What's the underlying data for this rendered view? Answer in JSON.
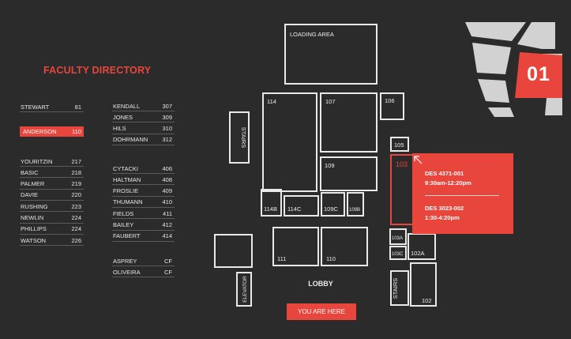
{
  "directory": {
    "title": "FACULTY DIRECTORY",
    "col1_groups": [
      [
        {
          "name": "STEWART",
          "room": "81"
        }
      ],
      [
        {
          "name": "ANDERSON",
          "room": "110",
          "highlight": true
        }
      ],
      [
        {
          "name": "YOURITZIN",
          "room": "217"
        },
        {
          "name": "BASIC",
          "room": "218"
        },
        {
          "name": "PALMER",
          "room": "219"
        },
        {
          "name": "DAVIE",
          "room": "220"
        },
        {
          "name": "RUSHING",
          "room": "223"
        },
        {
          "name": "NEWLIN",
          "room": "224"
        },
        {
          "name": "PHILLIPS",
          "room": "224"
        },
        {
          "name": "WATSON",
          "room": "226"
        }
      ]
    ],
    "col2_groups": [
      [
        {
          "name": "KENDALL",
          "room": "307"
        },
        {
          "name": "JONES",
          "room": "309"
        },
        {
          "name": "HILS",
          "room": "310"
        },
        {
          "name": "DOHRMANN",
          "room": "312"
        }
      ],
      [
        {
          "name": "CYTACKI",
          "room": "406"
        },
        {
          "name": "HALTMAN",
          "room": "408"
        },
        {
          "name": "FROSLIE",
          "room": "409"
        },
        {
          "name": "THUMANN",
          "room": "410"
        },
        {
          "name": "FIELDS",
          "room": "411"
        },
        {
          "name": "BAILEY",
          "room": "412"
        },
        {
          "name": "FAUBERT",
          "room": "414"
        }
      ],
      [
        {
          "name": "ASPREY",
          "room": "CF"
        },
        {
          "name": "OLIVEIRA",
          "room": "CF"
        }
      ]
    ]
  },
  "map": {
    "rooms": {
      "loading": "LOADING AREA",
      "r114": "114",
      "r107": "107",
      "r106": "106",
      "r105": "105",
      "r103": "103",
      "r109": "109",
      "r114b": "114B",
      "r114c": "114C",
      "r109c": "109C",
      "r109b": "109B",
      "r103a": "103A",
      "r103c": "103C",
      "r102a": "102A",
      "r111": "111",
      "r110": "110",
      "r102": "102",
      "stairs_left": "STAIRS",
      "stairs_right": "STAIRS",
      "elevator": "ELEVATOR"
    },
    "lobby": "LOBBY",
    "you_are_here": "YOU ARE HERE",
    "selected_room": "103"
  },
  "popup": {
    "class1_code": "DES 4371-001",
    "class1_time": "9:30am-12:20pm",
    "class2_code": "DES 3023-002",
    "class2_time": "1:30-4:20pm"
  },
  "level": {
    "number": "01"
  },
  "colors": {
    "accent": "#e8453c",
    "background": "#2b2b2b",
    "line": "#e9e9e9",
    "level_shape": "#d2d2d2"
  }
}
